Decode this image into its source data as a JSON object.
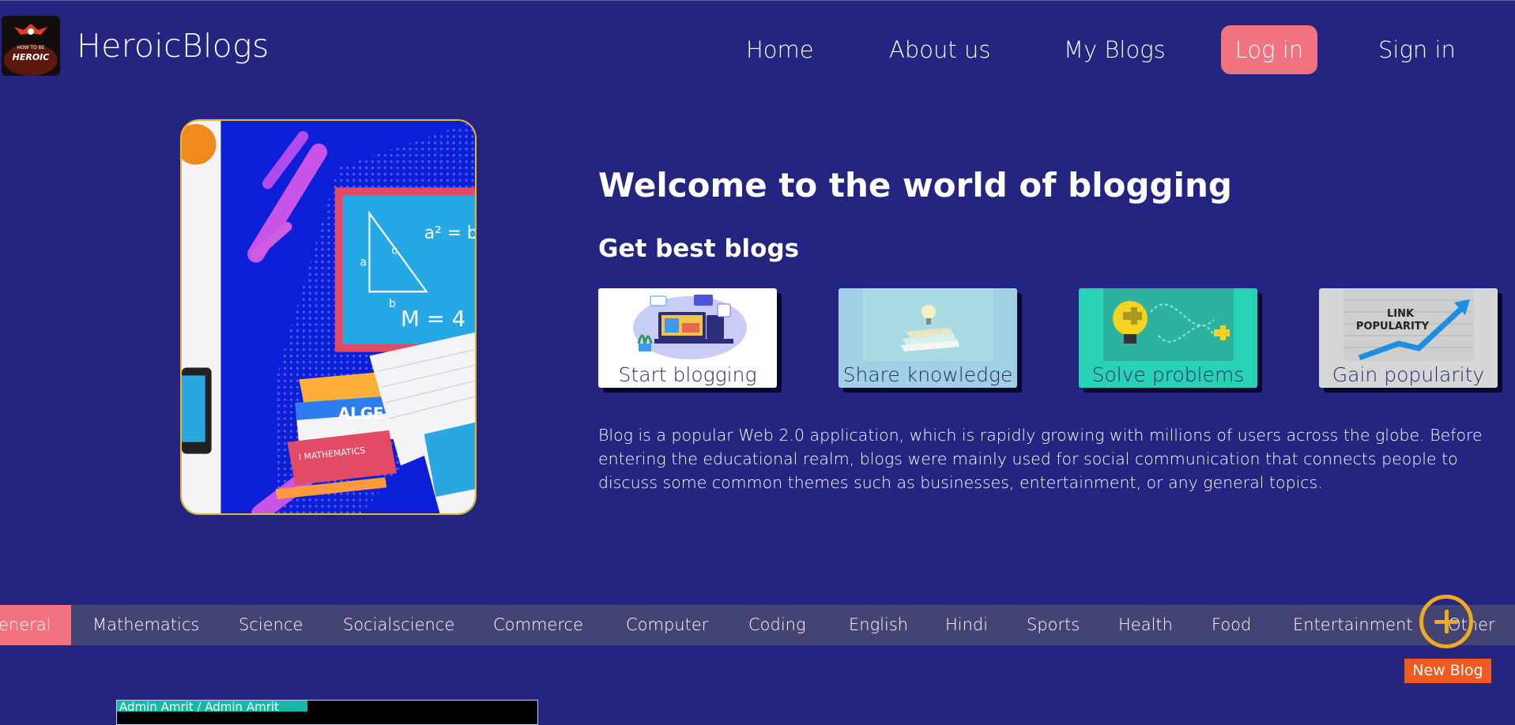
{
  "header": {
    "logo_text": "HOW TO BE HEROIC",
    "brand": "HeroicBlogs",
    "nav": {
      "home": "Home",
      "about": "About us",
      "my_blogs": "My Blogs",
      "login": "Log in",
      "signin": "Sign in"
    }
  },
  "hero": {
    "title": "Welcome to the world of blogging",
    "subtitle": "Get best blogs",
    "cards": [
      {
        "label": "Start blogging",
        "bg": "#ffffff"
      },
      {
        "label": "Share knowledge",
        "bg": "#9fd0e4"
      },
      {
        "label": "Solve problems",
        "bg": "#27d3b4"
      },
      {
        "label": "Gain popularity",
        "bg": "#d6d6d6"
      }
    ],
    "description": "Blog is a popular Web 2.0 application, which is rapidly growing with millions of users across the globe. Before entering the educational realm, blogs were mainly used for social communication that connects people to discuss some common themes such as businesses, entertainment, or any general topics."
  },
  "categories": {
    "active": "General",
    "items": [
      "eneral",
      "Mathematics",
      "Science",
      "Socialscience",
      "Commerce",
      "Computer",
      "Coding",
      "English",
      "Hindi",
      "Sports",
      "Health",
      "Food",
      "Entertainment",
      "Other"
    ]
  },
  "new_blog": {
    "label": "New Blog"
  },
  "post_preview": {
    "author": "Admin  Amrit / Admin  Amrit"
  },
  "colors": {
    "background": "#232581",
    "accent": "#f0737f",
    "new_blog": "#f05a1e",
    "plus_ring": "#f3a91f",
    "category_bar": "#434474"
  },
  "images": {
    "popularity_text_1": "LINK",
    "popularity_text_2": "POPULARITY",
    "book_text": "ALGE",
    "book_text_2": "MATHEMATICS"
  }
}
